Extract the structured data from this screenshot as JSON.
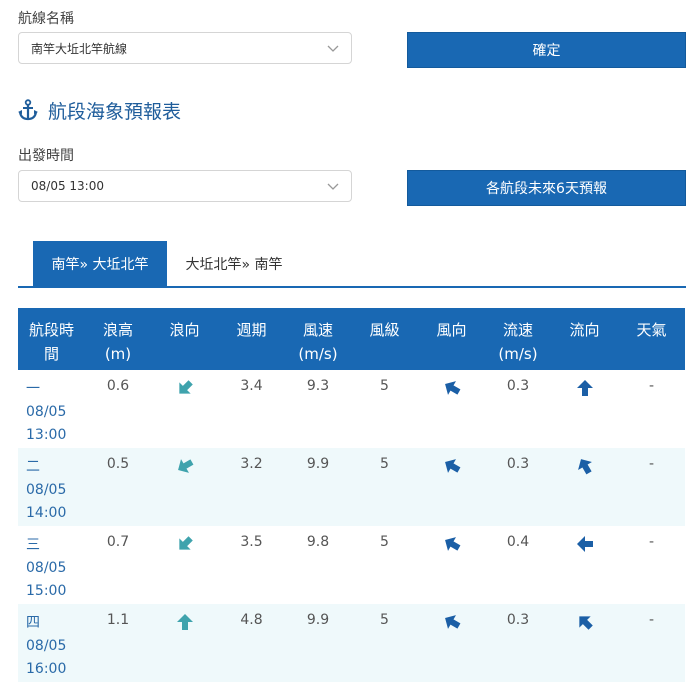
{
  "route": {
    "label": "航線名稱",
    "selected": "南竿大坵北竿航線",
    "confirm_label": "確定"
  },
  "section": {
    "icon": "anchor-icon",
    "title": "航段海象預報表"
  },
  "departure": {
    "label": "出發時間",
    "selected": "08/05 13:00",
    "forecast_button_label": "各航段未來6天預報"
  },
  "tabs": [
    {
      "label": "南竿» 大坵北竿",
      "active": true
    },
    {
      "label": "大坵北竿» 南竿",
      "active": false
    }
  ],
  "colors": {
    "primary": "#1968b3",
    "wave_arrow": "#3fa3ad",
    "wind_arrow": "#1b5fa6",
    "row_alt": "#eff9fb"
  },
  "table": {
    "headers": [
      {
        "line1": "航段時",
        "line2": "間"
      },
      {
        "line1": "浪高",
        "line2": "(m)"
      },
      {
        "line1": "浪向",
        "line2": ""
      },
      {
        "line1": "週期",
        "line2": ""
      },
      {
        "line1": "風速",
        "line2": "(m/s)"
      },
      {
        "line1": "風級",
        "line2": ""
      },
      {
        "line1": "風向",
        "line2": ""
      },
      {
        "line1": "流速",
        "line2": "(m/s)"
      },
      {
        "line1": "流向",
        "line2": ""
      },
      {
        "line1": "天氣",
        "line2": ""
      }
    ],
    "rows": [
      {
        "seg": "一",
        "date": "08/05",
        "time": "13:00",
        "wave_height": "0.6",
        "wave_dir_deg": 135,
        "period": "3.4",
        "wind_speed": "9.3",
        "wind_level": "5",
        "wind_dir_deg": 210,
        "current_speed": "0.3",
        "current_dir_deg": 270,
        "weather": "-"
      },
      {
        "seg": "二",
        "date": "08/05",
        "time": "14:00",
        "wave_height": "0.5",
        "wave_dir_deg": 150,
        "period": "3.2",
        "wind_speed": "9.9",
        "wind_level": "5",
        "wind_dir_deg": 210,
        "current_speed": "0.3",
        "current_dir_deg": 240,
        "weather": "-"
      },
      {
        "seg": "三",
        "date": "08/05",
        "time": "15:00",
        "wave_height": "0.7",
        "wave_dir_deg": 135,
        "period": "3.5",
        "wind_speed": "9.8",
        "wind_level": "5",
        "wind_dir_deg": 210,
        "current_speed": "0.4",
        "current_dir_deg": 180,
        "weather": "-"
      },
      {
        "seg": "四",
        "date": "08/05",
        "time": "16:00",
        "wave_height": "1.1",
        "wave_dir_deg": 270,
        "period": "4.8",
        "wind_speed": "9.9",
        "wind_level": "5",
        "wind_dir_deg": 210,
        "current_speed": "0.3",
        "current_dir_deg": 225,
        "weather": "-"
      }
    ]
  }
}
